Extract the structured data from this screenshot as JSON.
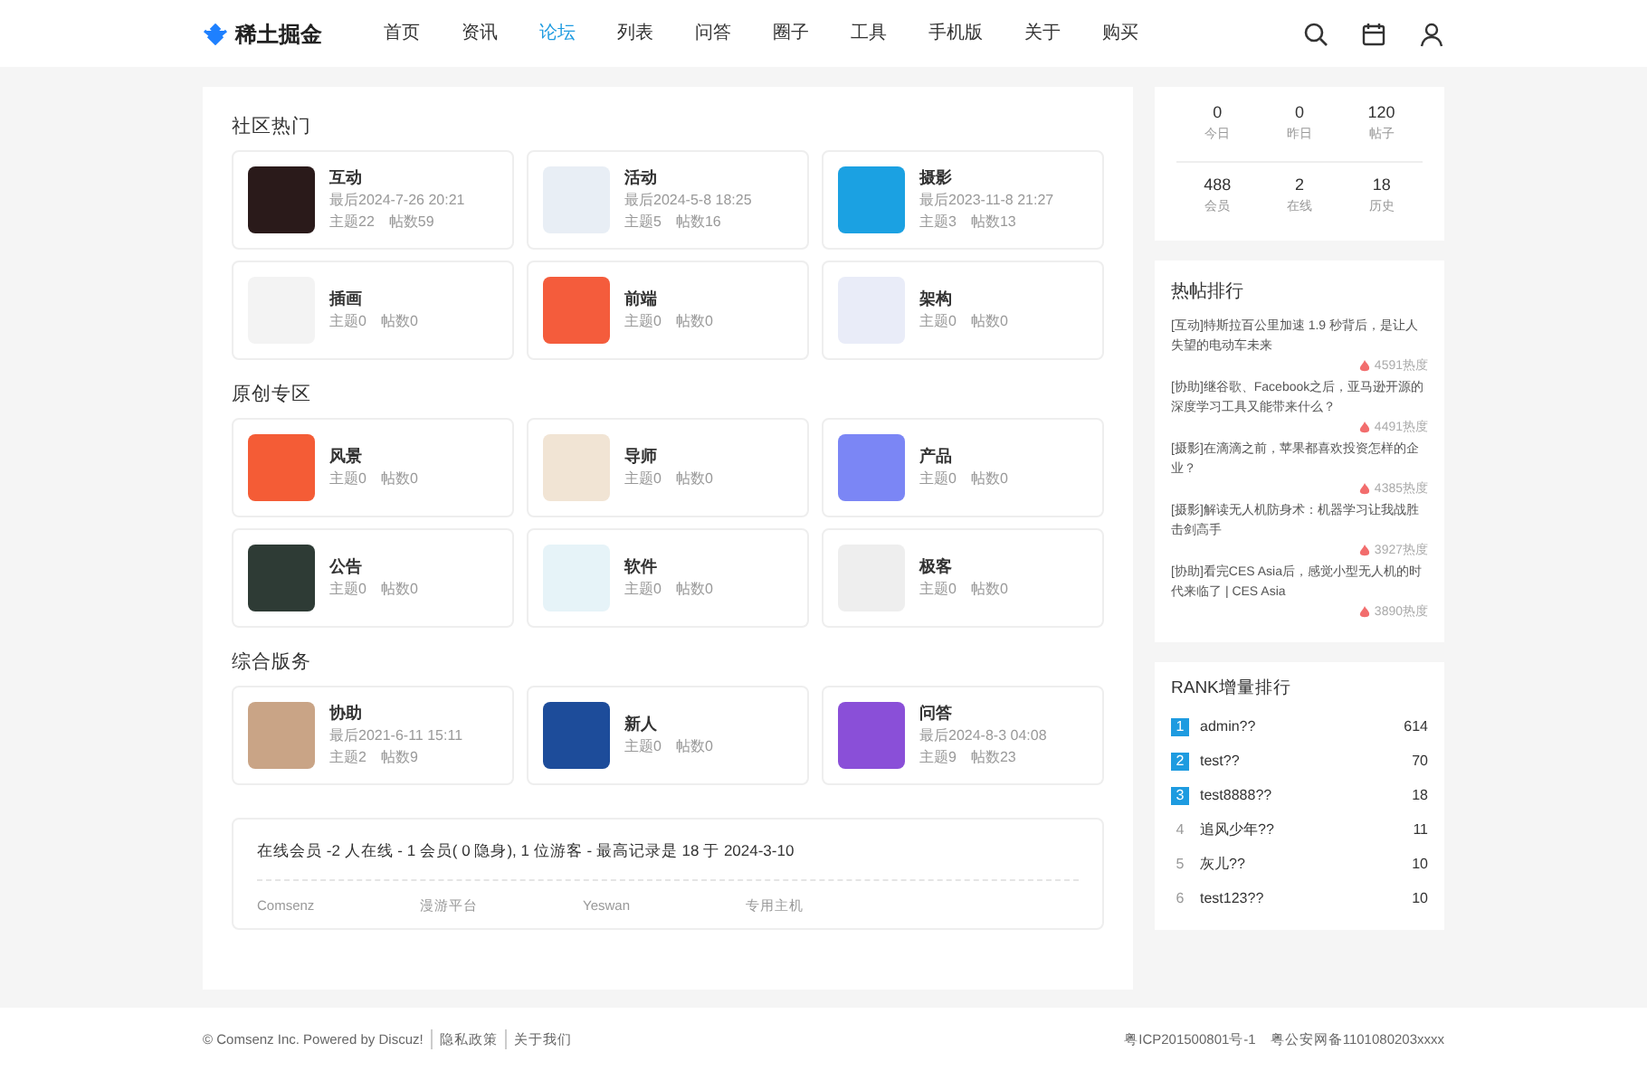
{
  "header": {
    "logo": "稀土掘金",
    "nav": [
      {
        "label": "首页",
        "selected": false
      },
      {
        "label": "资讯",
        "selected": false
      },
      {
        "label": "论坛",
        "selected": true
      },
      {
        "label": "列表",
        "selected": false
      },
      {
        "label": "问答",
        "selected": false
      },
      {
        "label": "圈子",
        "selected": false
      },
      {
        "label": "工具",
        "selected": false
      },
      {
        "label": "手机版",
        "selected": false
      },
      {
        "label": "关于",
        "selected": false
      },
      {
        "label": "购买",
        "selected": false
      }
    ]
  },
  "sections": [
    {
      "title": "社区热门",
      "forums": [
        {
          "name": "互动",
          "last": "最后2024-7-26 20:21",
          "topics": "主题22",
          "posts": "帖数59"
        },
        {
          "name": "活动",
          "last": "最后2024-5-8 18:25",
          "topics": "主题5",
          "posts": "帖数16"
        },
        {
          "name": "摄影",
          "last": "最后2023-11-8 21:27",
          "topics": "主题3",
          "posts": "帖数13"
        },
        {
          "name": "插画",
          "topics": "主题0",
          "posts": "帖数0"
        },
        {
          "name": "前端",
          "topics": "主题0",
          "posts": "帖数0"
        },
        {
          "name": "架构",
          "topics": "主题0",
          "posts": "帖数0"
        }
      ]
    },
    {
      "title": "原创专区",
      "forums": [
        {
          "name": "风景",
          "topics": "主题0",
          "posts": "帖数0"
        },
        {
          "name": "导师",
          "topics": "主题0",
          "posts": "帖数0"
        },
        {
          "name": "产品",
          "topics": "主题0",
          "posts": "帖数0"
        },
        {
          "name": "公告",
          "topics": "主题0",
          "posts": "帖数0"
        },
        {
          "name": "软件",
          "topics": "主题0",
          "posts": "帖数0"
        },
        {
          "name": "极客",
          "topics": "主题0",
          "posts": "帖数0"
        }
      ]
    },
    {
      "title": "综合版务",
      "forums": [
        {
          "name": "协助",
          "last": "最后2021-6-11 15:11",
          "topics": "主题2",
          "posts": "帖数9"
        },
        {
          "name": "新人",
          "topics": "主题0",
          "posts": "帖数0"
        },
        {
          "name": "问答",
          "last": "最后2024-8-3 04:08",
          "topics": "主题9",
          "posts": "帖数23"
        }
      ]
    }
  ],
  "online": {
    "text": "在线会员 -2 人在线 - 1 会员( 0 隐身), 1 位游客 - 最高记录是 18 于 2024-3-10",
    "links": [
      "Comsenz",
      "漫游平台",
      "Yeswan",
      "专用主机"
    ]
  },
  "stats": [
    {
      "value": "0",
      "label": "今日"
    },
    {
      "value": "0",
      "label": "昨日"
    },
    {
      "value": "120",
      "label": "帖子"
    },
    {
      "value": "488",
      "label": "会员"
    },
    {
      "value": "2",
      "label": "在线"
    },
    {
      "value": "18",
      "label": "历史"
    }
  ],
  "hot_posts": {
    "title": "热帖排行",
    "items": [
      {
        "title": "[互动]特斯拉百公里加速 1.9 秒背后，是让人失望的电动车未来",
        "heat": "4591热度"
      },
      {
        "title": "[协助]继谷歌、Facebook之后，亚马逊开源的深度学习工具又能带来什么？",
        "heat": "4491热度"
      },
      {
        "title": "[摄影]在滴滴之前，苹果都喜欢投资怎样的企业？",
        "heat": "4385热度"
      },
      {
        "title": "[摄影]解读无人机防身术：机器学习让我战胜击剑高手",
        "heat": "3927热度"
      },
      {
        "title": "[协助]看完CES Asia后，感觉小型无人机的时代来临了 | CES Asia",
        "heat": "3890热度"
      }
    ]
  },
  "rank": {
    "title": "RANK增量排行",
    "items": [
      {
        "rank": "1",
        "name": "admin??",
        "score": "614",
        "highlight": true
      },
      {
        "rank": "2",
        "name": "test??",
        "score": "70",
        "highlight": true
      },
      {
        "rank": "3",
        "name": "test8888??",
        "score": "18",
        "highlight": true
      },
      {
        "rank": "4",
        "name": "追风少年??",
        "score": "11",
        "highlight": false
      },
      {
        "rank": "5",
        "name": "灰儿??",
        "score": "10",
        "highlight": false
      },
      {
        "rank": "6",
        "name": "test123??",
        "score": "10",
        "highlight": false
      }
    ]
  },
  "footer": {
    "copyright": "© Comsenz Inc. Powered by Discuz!",
    "links": [
      "隐私政策",
      "关于我们"
    ],
    "icp": "粤ICP201500801号-1",
    "police": "粤公安网备1101080203xxxx"
  }
}
